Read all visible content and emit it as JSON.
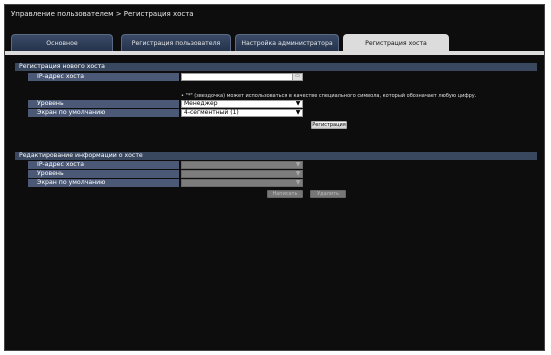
{
  "header": {
    "breadcrumb": "Управление пользователем > Регистрация хоста"
  },
  "tabs": [
    {
      "label": "Основное"
    },
    {
      "label": "Регистрация пользователя"
    },
    {
      "label": "Настройка администратора"
    },
    {
      "label": "Регистрация хоста"
    }
  ],
  "active_tab": "Регистрация хоста",
  "new_host": {
    "section_title": "Регистрация нового хоста",
    "ip_label": "IP-адрес хоста",
    "ip_value": "",
    "note": "• \"*\" (звездочка) может использоваться в качестве специального символа, который обозначает любую цифру.",
    "level_label": "Уровень",
    "level_value": "Менеджер",
    "screen_label": "Экран по умолчанию",
    "screen_value": "4-сегментный (1)",
    "register_button": "Регистрация"
  },
  "edit_host": {
    "section_title": "Редактирование информации о хосте",
    "ip_label": "IP-адрес хоста",
    "level_label": "Уровень",
    "screen_label": "Экран по умолчанию",
    "apply_button": "Написать",
    "delete_button": "Удалить"
  },
  "colors": {
    "background": "#0d0d0d",
    "section_bar": "#39475f",
    "label_cell": "#4b5977",
    "active_tab": "#dcdcdc"
  }
}
